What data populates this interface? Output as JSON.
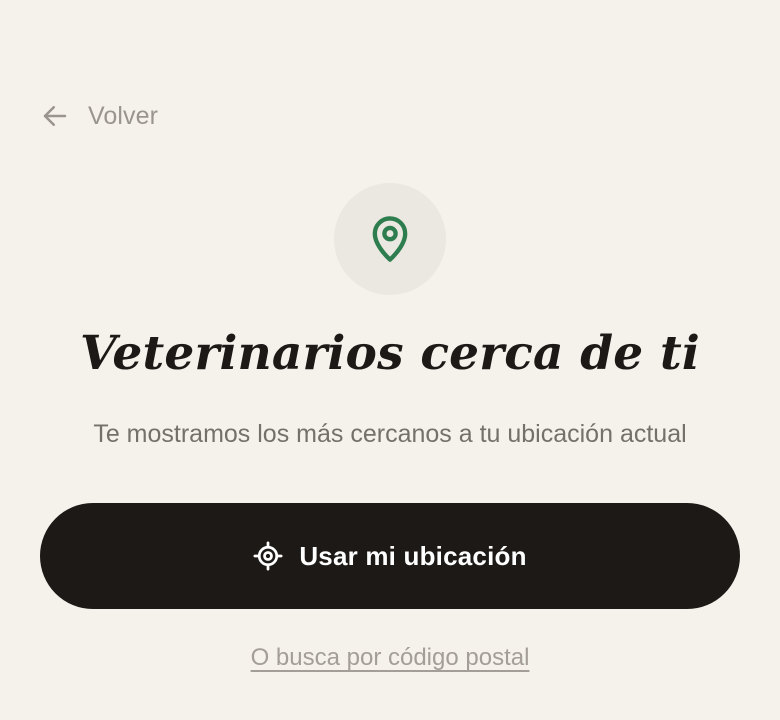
{
  "nav": {
    "back_label": "Volver",
    "back_icon": "arrow-left-icon"
  },
  "hero": {
    "icon": "map-pin-icon",
    "icon_color": "#2e7d4f",
    "title": "Veterinarios cerca de ti",
    "subtitle": "Te mostramos los más cercanos a tu ubicación actual"
  },
  "actions": {
    "use_location_label": "Usar mi ubicación",
    "use_location_icon": "crosshair-location-icon",
    "postal_search_label": "O busca por código postal"
  },
  "colors": {
    "background": "#f5f2ec",
    "primary_button": "#1c1916",
    "accent_green": "#2e7d4f",
    "muted_text": "#9a958e"
  }
}
